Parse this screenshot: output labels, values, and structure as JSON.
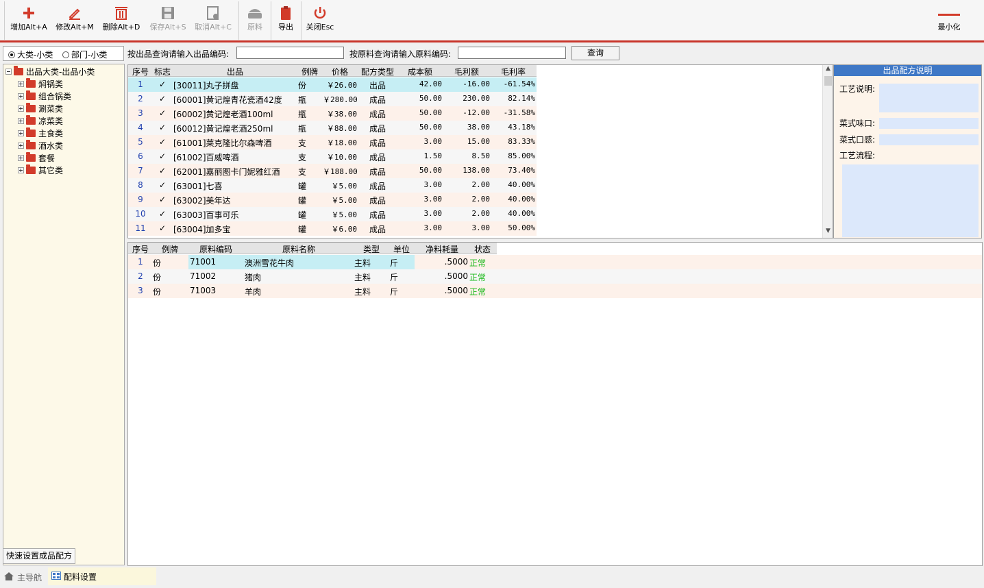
{
  "toolbar": {
    "buttons": [
      {
        "id": "add",
        "label": "增加Alt+A",
        "icon": "plus-icon",
        "disabled": false
      },
      {
        "id": "edit",
        "label": "修改Alt+M",
        "icon": "pencil-icon",
        "disabled": false
      },
      {
        "id": "delete",
        "label": "删除Alt+D",
        "icon": "trash-icon",
        "disabled": false
      },
      {
        "id": "save",
        "label": "保存Alt+S",
        "icon": "floppy-icon",
        "disabled": true
      },
      {
        "id": "cancel",
        "label": "取消Alt+C",
        "icon": "cancel-doc-icon",
        "disabled": true
      },
      {
        "id": "material",
        "label": "原料",
        "icon": "pot-icon",
        "disabled": true
      },
      {
        "id": "export",
        "label": "导出",
        "icon": "clipboard-icon",
        "disabled": false
      },
      {
        "id": "close",
        "label": "关闭Esc",
        "icon": "power-icon",
        "disabled": false
      }
    ],
    "minimize_label": "最小化",
    "accent_color": "#c8342a"
  },
  "left": {
    "radio_options": [
      {
        "label": "大类-小类",
        "checked": true
      },
      {
        "label": "部门-小类",
        "checked": false
      }
    ],
    "tree_root": "出品大类-出品小类",
    "tree_items": [
      "焖锅类",
      "组合锅类",
      "涮菜类",
      "凉菜类",
      "主食类",
      "酒水类",
      "套餐",
      "其它类"
    ],
    "quick_setup_label": "快速设置成品配方"
  },
  "search": {
    "product_label": "按出品查询请输入出品编码:",
    "product_value": "",
    "material_label": "按原料查询请输入原料编码:",
    "material_value": "",
    "query_label": "查询"
  },
  "product_grid": {
    "columns": [
      "序号",
      "标志",
      "出品",
      "例牌",
      "价格",
      "配方类型",
      "成本额",
      "毛利额",
      "毛利率"
    ],
    "rows": [
      {
        "no": "1",
        "flag": "✓",
        "name": "[30011]丸子拼盘",
        "unit": "份",
        "price": "￥26.00",
        "type": "出品",
        "cost": "42.00",
        "profit": "-16.00",
        "rate": "-61.54%"
      },
      {
        "no": "2",
        "flag": "✓",
        "name": "[60001]黄记煌青花瓷酒42度",
        "unit": "瓶",
        "price": "￥280.00",
        "type": "成品",
        "cost": "50.00",
        "profit": "230.00",
        "rate": "82.14%"
      },
      {
        "no": "3",
        "flag": "✓",
        "name": "[60002]黄记煌老酒100ml",
        "unit": "瓶",
        "price": "￥38.00",
        "type": "成品",
        "cost": "50.00",
        "profit": "-12.00",
        "rate": "-31.58%"
      },
      {
        "no": "4",
        "flag": "✓",
        "name": "[60012]黄记煌老酒250ml",
        "unit": "瓶",
        "price": "￥88.00",
        "type": "成品",
        "cost": "50.00",
        "profit": "38.00",
        "rate": "43.18%"
      },
      {
        "no": "5",
        "flag": "✓",
        "name": "[61001]莱克隆比尔森啤酒",
        "unit": "支",
        "price": "￥18.00",
        "type": "成品",
        "cost": "3.00",
        "profit": "15.00",
        "rate": "83.33%"
      },
      {
        "no": "6",
        "flag": "✓",
        "name": "[61002]百威啤酒",
        "unit": "支",
        "price": "￥10.00",
        "type": "成品",
        "cost": "1.50",
        "profit": "8.50",
        "rate": "85.00%"
      },
      {
        "no": "7",
        "flag": "✓",
        "name": "[62001]嘉丽图卡门妮雅红酒",
        "unit": "支",
        "price": "￥188.00",
        "type": "成品",
        "cost": "50.00",
        "profit": "138.00",
        "rate": "73.40%"
      },
      {
        "no": "8",
        "flag": "✓",
        "name": "[63001]七喜",
        "unit": "罐",
        "price": "￥5.00",
        "type": "成品",
        "cost": "3.00",
        "profit": "2.00",
        "rate": "40.00%"
      },
      {
        "no": "9",
        "flag": "✓",
        "name": "[63002]美年达",
        "unit": "罐",
        "price": "￥5.00",
        "type": "成品",
        "cost": "3.00",
        "profit": "2.00",
        "rate": "40.00%"
      },
      {
        "no": "10",
        "flag": "✓",
        "name": "[63003]百事可乐",
        "unit": "罐",
        "price": "￥5.00",
        "type": "成品",
        "cost": "3.00",
        "profit": "2.00",
        "rate": "40.00%"
      },
      {
        "no": "11",
        "flag": "✓",
        "name": "[63004]加多宝",
        "unit": "罐",
        "price": "￥6.00",
        "type": "成品",
        "cost": "3.00",
        "profit": "3.00",
        "rate": "50.00%"
      }
    ]
  },
  "description": {
    "title": "出品配方说明",
    "craft_label": "工艺说明:",
    "taste_label": "菜式味口:",
    "texture_label": "菜式口感:",
    "process_label": "工艺流程:"
  },
  "material_grid": {
    "columns": [
      "序号",
      "例牌",
      "原料编码",
      "原料名称",
      "类型",
      "单位",
      "净料耗量",
      "状态"
    ],
    "rows": [
      {
        "no": "1",
        "unit_type": "份",
        "code": "71001",
        "name": "澳洲雪花牛肉",
        "kind": "主料",
        "unit": "斤",
        "qty": ".5000",
        "status": "正常"
      },
      {
        "no": "2",
        "unit_type": "份",
        "code": "71002",
        "name": "猪肉",
        "kind": "主料",
        "unit": "斤",
        "qty": ".5000",
        "status": "正常"
      },
      {
        "no": "3",
        "unit_type": "份",
        "code": "71003",
        "name": "羊肉",
        "kind": "主料",
        "unit": "斤",
        "qty": ".5000",
        "status": "正常"
      }
    ],
    "status_color": "#18b818"
  },
  "tabs": [
    {
      "label": "主导航",
      "icon": "home-icon",
      "active": false
    },
    {
      "label": "配料设置",
      "icon": "grid-icon",
      "active": true
    }
  ]
}
